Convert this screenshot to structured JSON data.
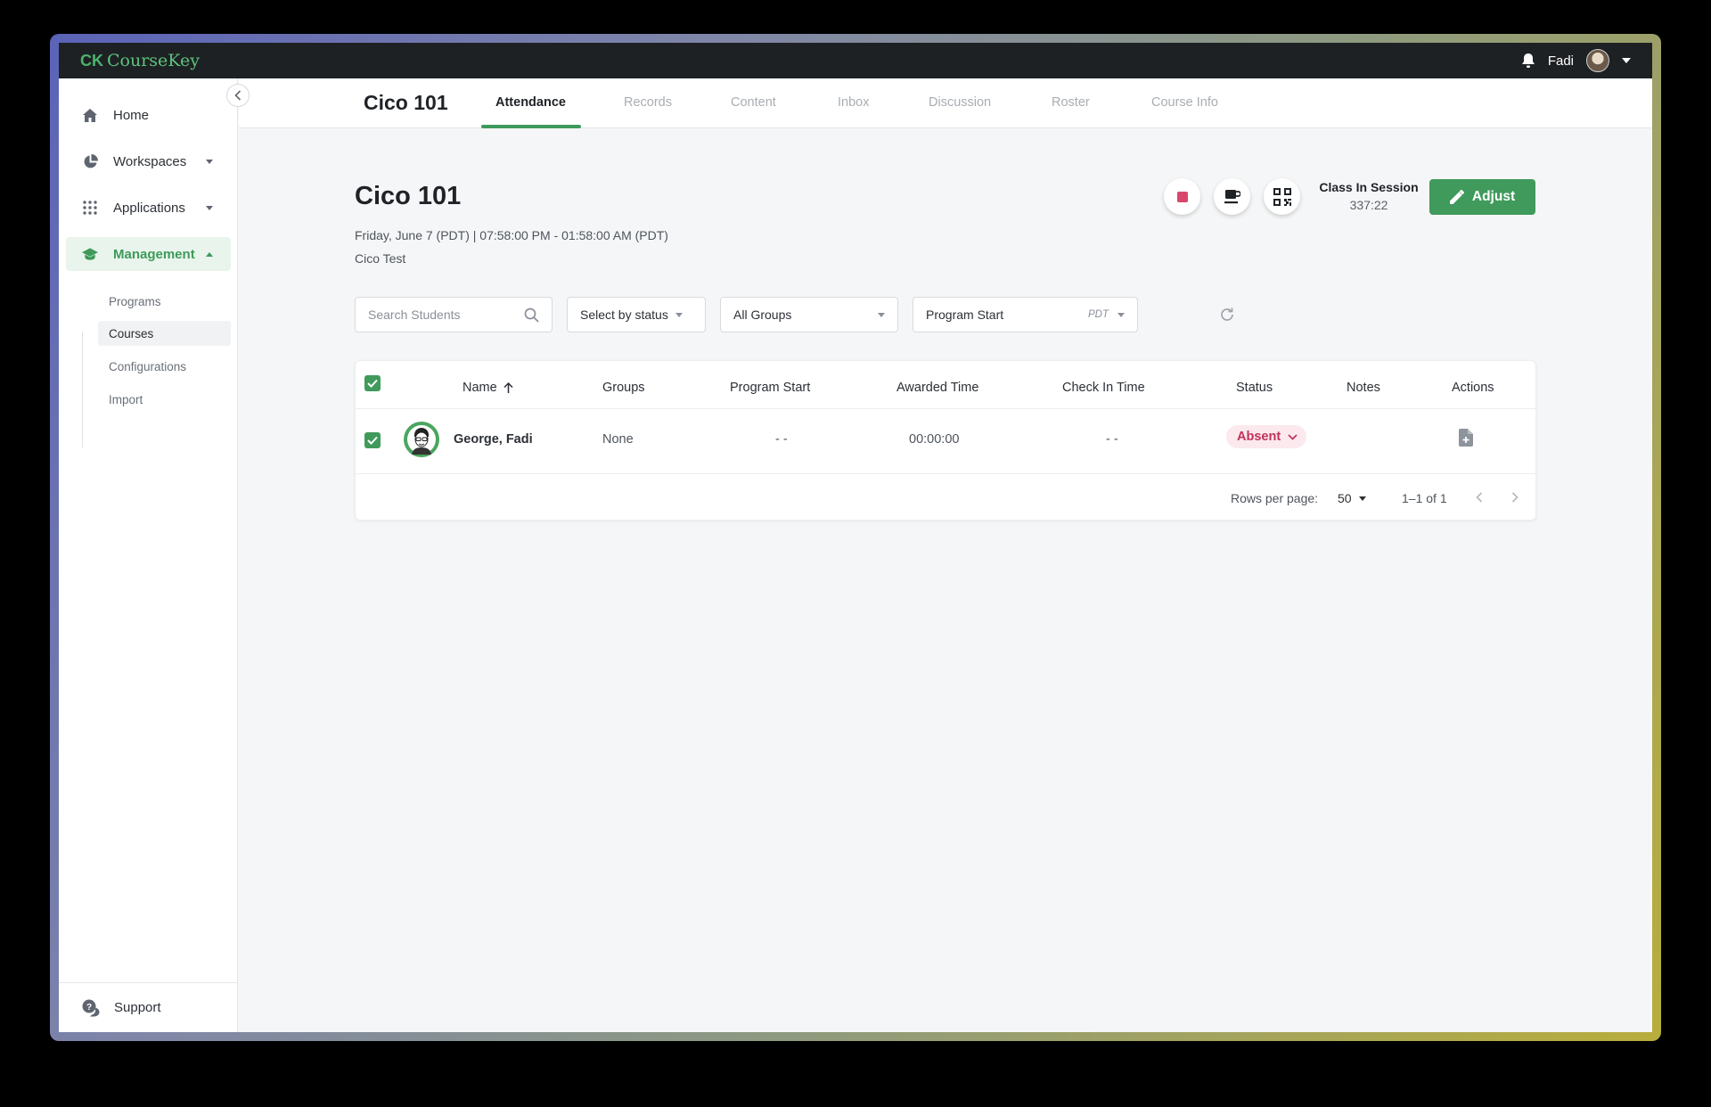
{
  "brand": {
    "prefix": "CK",
    "name_course": "Course",
    "name_key": "Key"
  },
  "user": {
    "name": "Fadi"
  },
  "sidebar": {
    "items": [
      {
        "label": "Home",
        "icon": "home-icon"
      },
      {
        "label": "Workspaces",
        "icon": "pie-chart-icon"
      },
      {
        "label": "Applications",
        "icon": "apps-grid-icon"
      },
      {
        "label": "Management",
        "icon": "graduation-cap-icon"
      }
    ],
    "sub_items": [
      {
        "label": "Programs"
      },
      {
        "label": "Courses"
      },
      {
        "label": "Configurations"
      },
      {
        "label": "Import"
      }
    ],
    "support_label": "Support"
  },
  "tabs": {
    "course_title": "Cico 101",
    "items": [
      {
        "label": "Attendance"
      },
      {
        "label": "Records"
      },
      {
        "label": "Content"
      },
      {
        "label": "Inbox"
      },
      {
        "label": "Discussion"
      },
      {
        "label": "Roster"
      },
      {
        "label": "Course Info"
      }
    ]
  },
  "page": {
    "title": "Cico 101",
    "datetime": "Friday, June 7 (PDT) | 07:58:00 PM - 01:58:00 AM (PDT)",
    "subtitle": "Cico Test",
    "session_label": "Class In Session",
    "session_time": "337:22",
    "adjust_label": "Adjust"
  },
  "filters": {
    "search_placeholder": "Search Students",
    "status_label": "Select by status",
    "groups_label": "All Groups",
    "time_label": "Program Start",
    "timezone": "PDT"
  },
  "table": {
    "columns": [
      "Name",
      "Groups",
      "Program Start",
      "Awarded Time",
      "Check In Time",
      "Status",
      "Notes",
      "Actions"
    ],
    "rows": [
      {
        "name": "George, Fadi",
        "groups": "None",
        "program_start": "- -",
        "awarded_time": "00:00:00",
        "check_in_time": "- -",
        "status": "Absent",
        "notes": ""
      }
    ],
    "rows_per_page_label": "Rows per page:",
    "rows_per_page": "50",
    "range": "1–1 of 1"
  },
  "colors": {
    "accent": "#3f9a5b",
    "absent": "#c2325a",
    "stop": "#d8466b"
  }
}
